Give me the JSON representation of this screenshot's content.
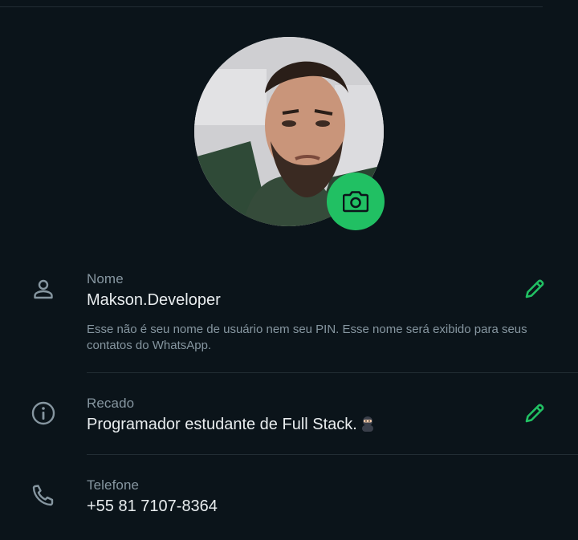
{
  "profile": {
    "camera_icon": "camera-icon",
    "accent_color": "#21c063"
  },
  "fields": {
    "name": {
      "label": "Nome",
      "value": "Makson.Developer",
      "hint": "Esse não é seu nome de usuário nem seu PIN. Esse nome será exibido para seus contatos do WhatsApp.",
      "icon": "person-icon",
      "edit_icon": "pencil-icon"
    },
    "about": {
      "label": "Recado",
      "value": "Programador estudante de Full Stack.",
      "emoji": "ninja-emoji",
      "icon": "info-icon",
      "edit_icon": "pencil-icon"
    },
    "phone": {
      "label": "Telefone",
      "value": "+55 81 7107-8364",
      "icon": "phone-icon"
    }
  }
}
